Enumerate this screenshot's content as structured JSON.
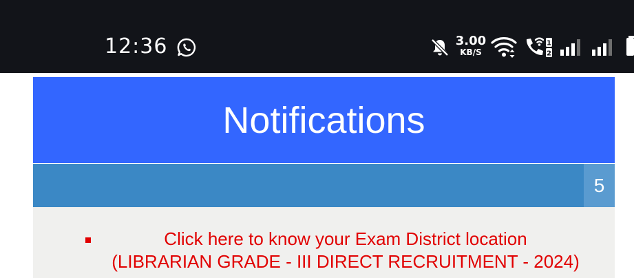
{
  "status_bar": {
    "time": "12:36",
    "net_speed_value": "3.00",
    "net_speed_unit": "KB/S",
    "sim_slot_1": "1",
    "sim_slot_2": "2",
    "icons": [
      "whatsapp-icon",
      "bell-off-icon",
      "wifi-icon",
      "wifi-calling-icon",
      "signal-icon",
      "signal-icon",
      "battery-icon"
    ]
  },
  "header": {
    "title": "Notifications"
  },
  "subheader": {
    "count": "5"
  },
  "notifications": [
    {
      "line1": "Click here to know your Exam District location",
      "line2": "(LIBRARIAN GRADE - III DIRECT RECRUITMENT - 2024)"
    }
  ],
  "colors": {
    "status_bar_bg": "#121419",
    "header_bg": "#3366ff",
    "subheader_bg": "#3b88c5",
    "badge_bg": "#5a9bd0",
    "panel_bg": "#f0f0ee",
    "link_red": "#e10000"
  }
}
